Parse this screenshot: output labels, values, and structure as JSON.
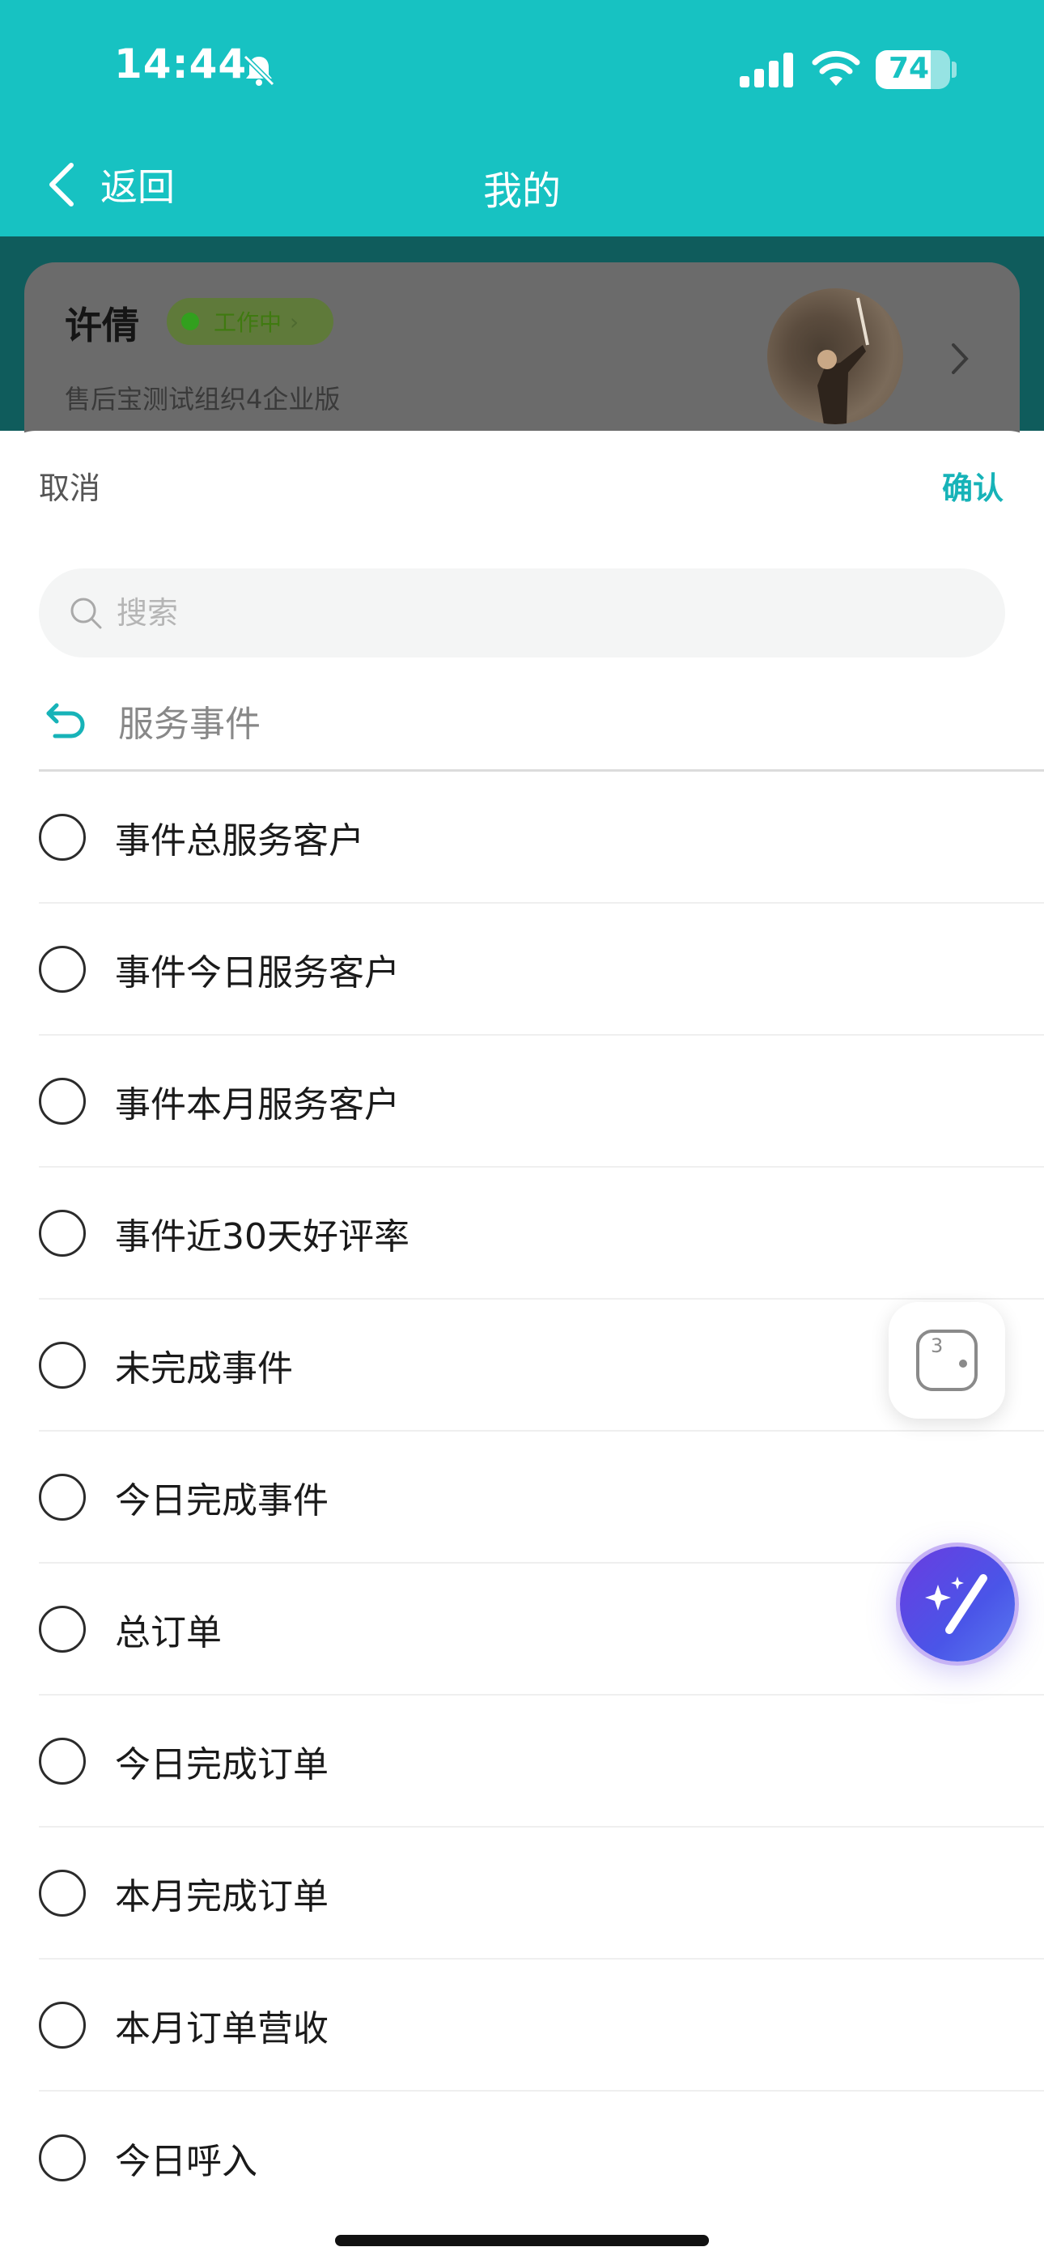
{
  "status_bar": {
    "time": "14:44",
    "battery_level": "74",
    "battery_fraction": 0.74
  },
  "nav": {
    "back_label": "返回",
    "title": "我的"
  },
  "profile": {
    "name": "许倩",
    "status": "工作中",
    "organization": "售后宝测试组织4企业版"
  },
  "sheet": {
    "cancel_label": "取消",
    "confirm_label": "确认",
    "search_placeholder": "搜索",
    "breadcrumb_label": "服务事件",
    "items": [
      {
        "label": "事件总服务客户"
      },
      {
        "label": "事件今日服务客户"
      },
      {
        "label": "事件本月服务客户"
      },
      {
        "label": "事件近30天好评率"
      },
      {
        "label": "未完成事件"
      },
      {
        "label": "今日完成事件"
      },
      {
        "label": "总订单"
      },
      {
        "label": "今日完成订单"
      },
      {
        "label": "本月完成订单"
      },
      {
        "label": "本月订单营收"
      },
      {
        "label": "今日呼入"
      }
    ]
  },
  "floating": {
    "widget_badge": "3"
  },
  "colors": {
    "header": "#17c2c2",
    "accent": "#17b3b8"
  },
  "icons": {
    "bell": "bell-off-icon",
    "signal": "signal-icon",
    "wifi": "wifi-icon",
    "back": "chevron-left-icon",
    "search": "search-icon",
    "breadcrumb_back": "return-arrow-icon",
    "ai": "magic-wand-icon"
  }
}
